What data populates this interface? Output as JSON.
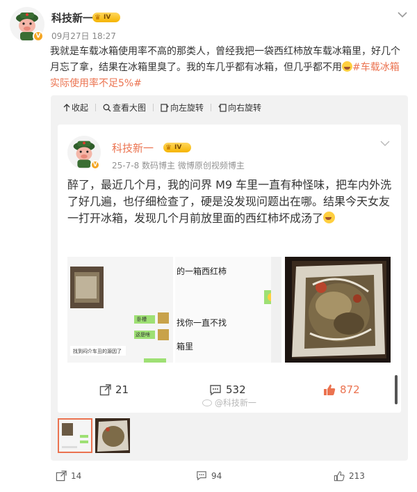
{
  "post": {
    "author": "科技新一",
    "level": "IV",
    "timestamp": "09月27日 18:27",
    "text_before_tag": "我就是车载冰箱使用率不高的那类人，曾经我把一袋西红柿放车载冰箱里，好几个月忘了拿，结果在冰箱里臭了。我的车几乎都有冰箱，但几乎都不用",
    "hashtag": "#车载冰箱实际使用率不足5%#"
  },
  "toolbar": {
    "collapse": "收起",
    "view_large": "查看大图",
    "rotate_left": "向左旋转",
    "rotate_right": "向右旋转"
  },
  "repost": {
    "author": "科技新一",
    "level": "IV",
    "meta": "25-7-8  数码博主 微博原创视频博主",
    "text": "醉了，最近几个月，我的问界 M9 车里一直有种怪味，把车内外洗了好几遍，也仔细检查了，硬是没发现问题出在哪。结果今天女友一打开冰箱，发现几个月前放里面的西红柿坏成汤了",
    "img2_line1": "的一箱西红柿",
    "img2_line2": "找你一直不找",
    "img2_line3": "箱里",
    "img1_bubble1": "卧槽",
    "img1_bubble2": "这是啥",
    "img1_line": "找到闷介车丑的源因了",
    "reposts": "21",
    "comments": "532",
    "likes": "872"
  },
  "watermark": "@科技新一",
  "actions": {
    "reposts": "14",
    "comments": "94",
    "likes": "213"
  },
  "colors": {
    "accent": "#eb7350",
    "badge": "#f5a623"
  }
}
